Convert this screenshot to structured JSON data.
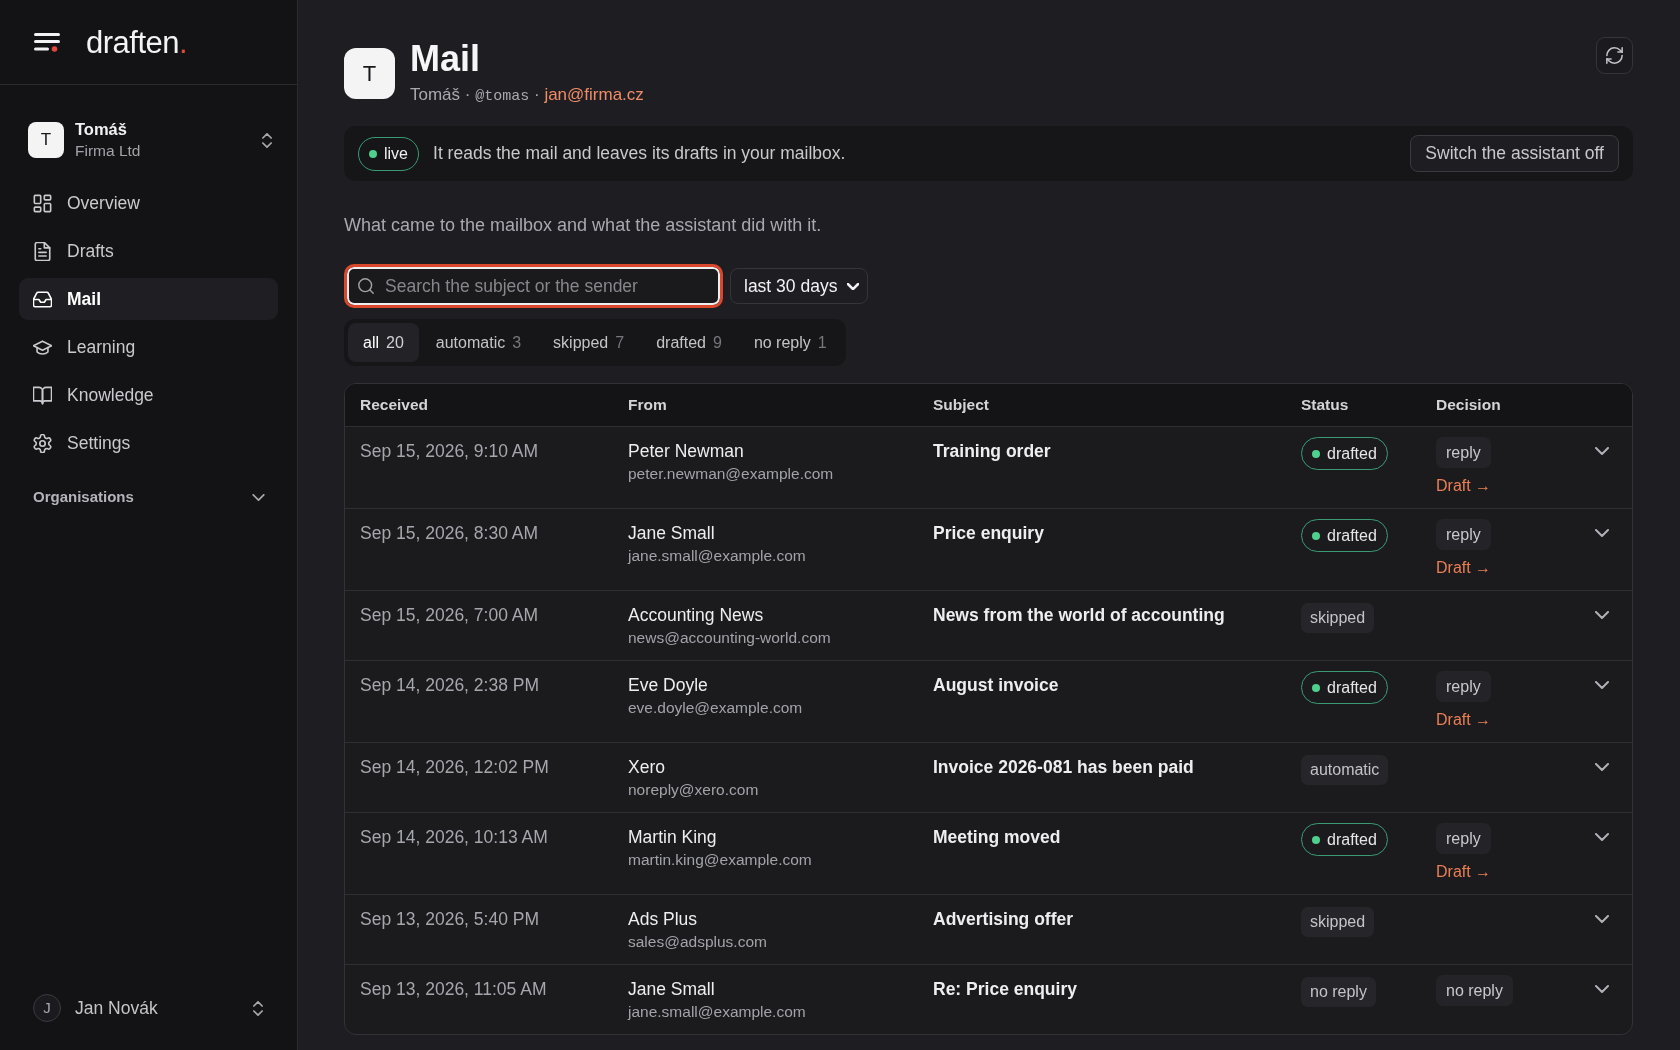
{
  "sidebar": {
    "logo": {
      "text": "draften",
      "dot": "."
    },
    "account": {
      "avatar": "T",
      "name": "Tomáš",
      "org": "Firma Ltd"
    },
    "nav": [
      {
        "label": "Overview",
        "selected": false
      },
      {
        "label": "Drafts",
        "selected": false
      },
      {
        "label": "Mail",
        "selected": true
      },
      {
        "label": "Learning",
        "selected": false
      },
      {
        "label": "Knowledge",
        "selected": false
      },
      {
        "label": "Settings",
        "selected": false
      }
    ],
    "section": {
      "label": "Organisations",
      "expanded": false
    },
    "user": {
      "avatar": "J",
      "name": "Jan Novák"
    }
  },
  "header": {
    "avatar": "T",
    "title": "Mail",
    "subtitle": [
      {
        "kind": "text",
        "text": "Tomáš"
      },
      {
        "kind": "text",
        "text": "·"
      },
      {
        "kind": "mono",
        "text": "@tomas"
      },
      {
        "kind": "text",
        "text": "·"
      },
      {
        "kind": "link",
        "text": "jan@firma.cz"
      }
    ]
  },
  "banner": {
    "live": true,
    "badge": "live",
    "text": "It reads the mail and leaves its drafts in your mailbox.",
    "button": "Switch the assistant off"
  },
  "description": "What came to the mailbox and what the assistant did with it.",
  "search": {
    "placeholder": "Search the subject or the sender",
    "focused": true
  },
  "period": {
    "value": "last 30 days"
  },
  "filters": [
    {
      "label": "all",
      "count": "20",
      "selected": true
    },
    {
      "label": "automatic",
      "count": "3",
      "selected": false
    },
    {
      "label": "skipped",
      "count": "7",
      "selected": false
    },
    {
      "label": "drafted",
      "count": "9",
      "selected": false
    },
    {
      "label": "no reply",
      "count": "1",
      "selected": false
    }
  ],
  "table": {
    "columns": [
      "Received",
      "From",
      "Subject",
      "Status",
      "Decision"
    ],
    "rows": [
      {
        "received": "Sep 15, 2026, 9:10 AM",
        "sender": "Peter Newman",
        "email": "peter.newman@example.com",
        "subject": "Training order",
        "status": {
          "kind": "drafted",
          "label": "drafted"
        },
        "decision": {
          "label": "reply",
          "link": "Draft →"
        },
        "expanded": false
      },
      {
        "received": "Sep 15, 2026, 8:30 AM",
        "sender": "Jane Small",
        "email": "jane.small@example.com",
        "subject": "Price enquiry",
        "status": {
          "kind": "drafted",
          "label": "drafted"
        },
        "decision": {
          "label": "reply",
          "link": "Draft →"
        },
        "expanded": false
      },
      {
        "received": "Sep 15, 2026, 7:00 AM",
        "sender": "Accounting News",
        "email": "news@accounting-world.com",
        "subject": "News from the world of accounting",
        "status": {
          "kind": "skipped",
          "label": "skipped"
        },
        "expanded": false
      },
      {
        "received": "Sep 14, 2026, 2:38 PM",
        "sender": "Eve Doyle",
        "email": "eve.doyle@example.com",
        "subject": "August invoice",
        "status": {
          "kind": "drafted",
          "label": "drafted"
        },
        "decision": {
          "label": "reply",
          "link": "Draft →"
        },
        "expanded": false
      },
      {
        "received": "Sep 14, 2026, 12:02 PM",
        "sender": "Xero",
        "email": "noreply@xero.com",
        "subject": "Invoice 2026-081 has been paid",
        "status": {
          "kind": "automatic",
          "label": "automatic"
        },
        "expanded": false
      },
      {
        "received": "Sep 14, 2026, 10:13 AM",
        "sender": "Martin King",
        "email": "martin.king@example.com",
        "subject": "Meeting moved",
        "status": {
          "kind": "drafted",
          "label": "drafted"
        },
        "decision": {
          "label": "reply",
          "link": "Draft →"
        },
        "expanded": false
      },
      {
        "received": "Sep 13, 2026, 5:40 PM",
        "sender": "Ads Plus",
        "email": "sales@adsplus.com",
        "subject": "Advertising offer",
        "status": {
          "kind": "skipped",
          "label": "skipped"
        },
        "expanded": false
      },
      {
        "received": "Sep 13, 2026, 11:05 AM",
        "sender": "Jane Small",
        "email": "jane.small@example.com",
        "subject": "Re: Price enquiry",
        "status": {
          "kind": "no_reply",
          "label": "no reply"
        },
        "decision": {
          "label": "no reply"
        },
        "expanded": false
      }
    ]
  }
}
